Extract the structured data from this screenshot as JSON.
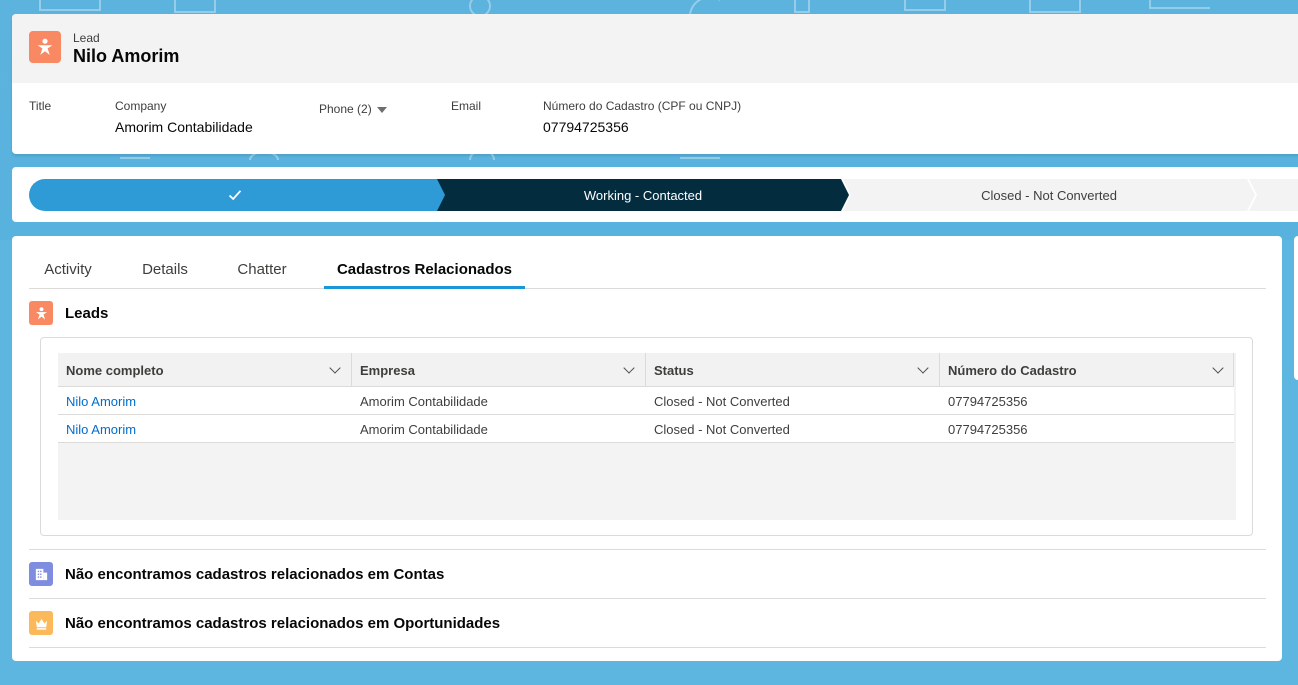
{
  "colors": {
    "background": "#5db6e0",
    "lead_icon": "#f88962",
    "path_complete": "#2e9bd6",
    "path_current": "#032d3f",
    "link": "#006dcc",
    "tab_active_underline": "#1b96d7",
    "account_icon": "#7f8de1",
    "opportunity_icon": "#fcb95b"
  },
  "header": {
    "icon": "lead-star-icon",
    "record_type": "Lead",
    "record_name": "Nilo Amorim",
    "highlights": {
      "title_label": "Title",
      "company_label": "Company",
      "company_value": "Amorim Contabilidade",
      "phone_label": "Phone (2)",
      "email_label": "Email",
      "cadastro_label": "Número do Cadastro (CPF ou CNPJ)",
      "cadastro_value": "07794725356"
    }
  },
  "path": {
    "complete_icon": "checkmark-icon",
    "current": "Working - Contacted",
    "next": "Closed - Not Converted"
  },
  "tabs": [
    {
      "label": "Activity"
    },
    {
      "label": "Details"
    },
    {
      "label": "Chatter"
    },
    {
      "label": "Cadastros Relacionados"
    }
  ],
  "active_tab": "Cadastros Relacionados",
  "leads_section": {
    "icon": "lead-star-icon",
    "title": "Leads",
    "columns": [
      "Nome completo",
      "Empresa",
      "Status",
      "Número do Cadastro"
    ],
    "rows": [
      {
        "nome": "Nilo Amorim",
        "empresa": "Amorim Contabilidade",
        "status": "Closed - Not Converted",
        "numero": "07794725356"
      },
      {
        "nome": "Nilo Amorim",
        "empresa": "Amorim Contabilidade",
        "status": "Closed - Not Converted",
        "numero": "07794725356"
      }
    ]
  },
  "contas_section": {
    "icon": "account-building-icon",
    "title": "Não encontramos cadastros relacionados em Contas"
  },
  "oportunidades_section": {
    "icon": "opportunity-crown-icon",
    "title": "Não encontramos cadastros relacionados em Oportunidades"
  }
}
